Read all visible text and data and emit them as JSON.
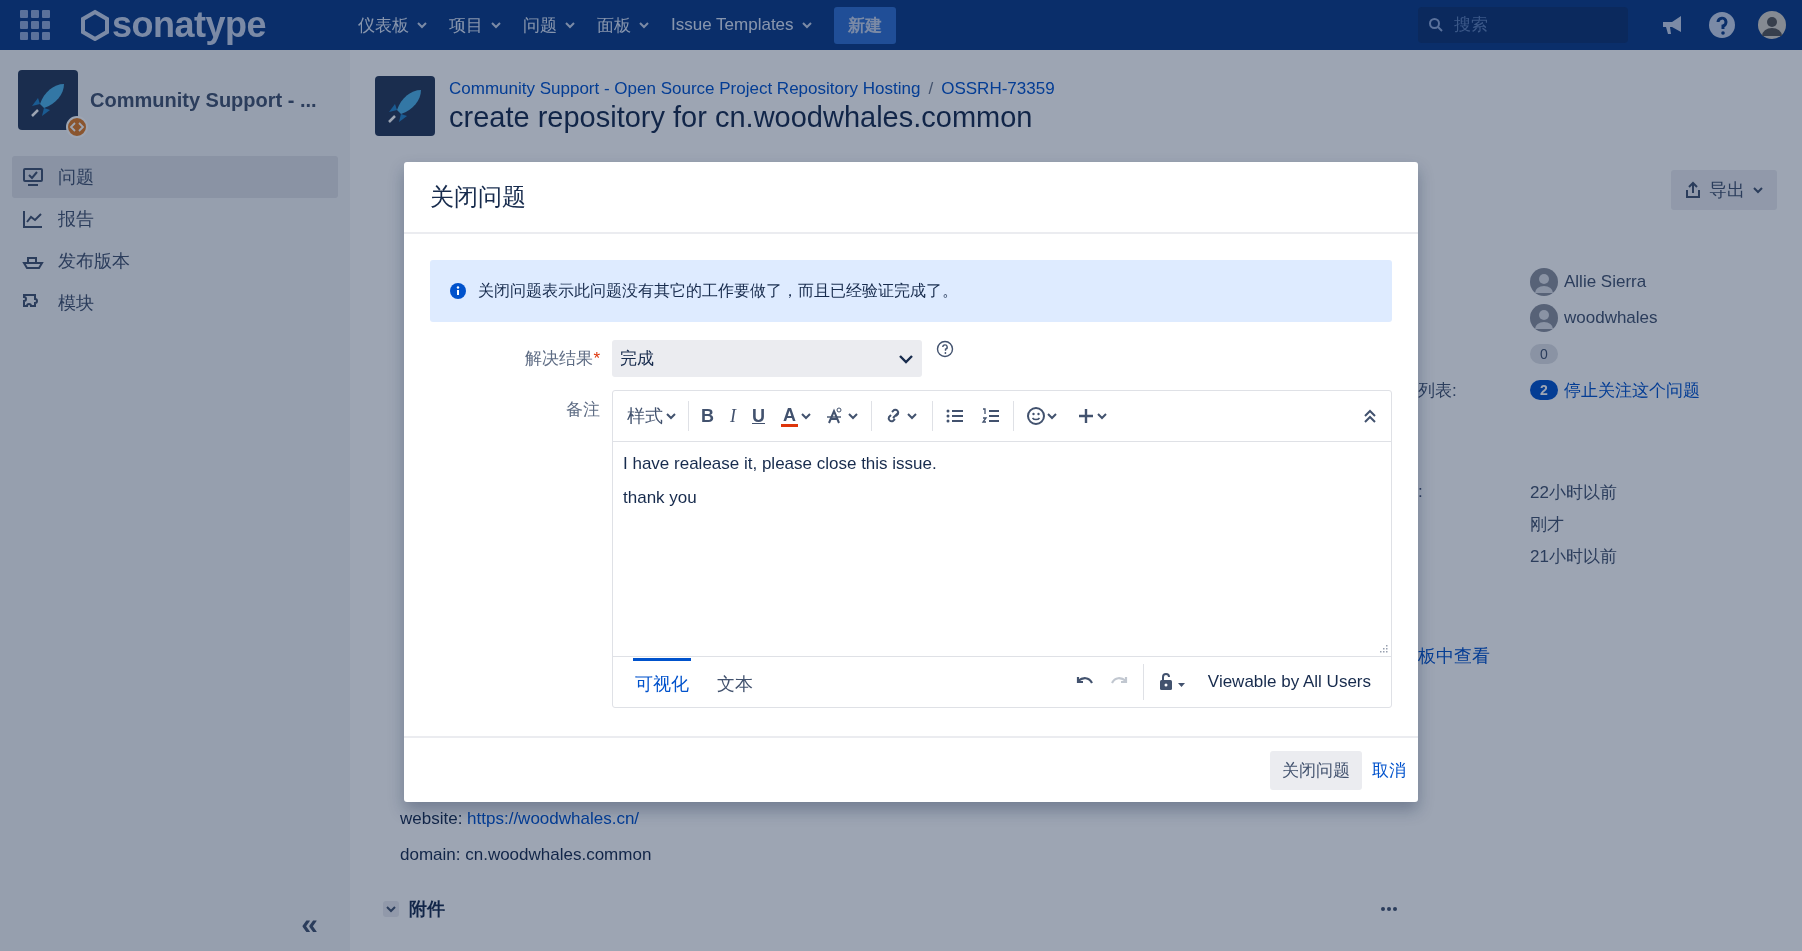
{
  "topbar": {
    "logo": "sonatype",
    "menus": [
      {
        "label": "仪表板"
      },
      {
        "label": "项目"
      },
      {
        "label": "问题"
      },
      {
        "label": "面板"
      },
      {
        "label": "Issue Templates"
      }
    ],
    "create": "新建",
    "search": {
      "placeholder": "搜索"
    }
  },
  "sidebar": {
    "project": "Community Support - ...",
    "items": [
      {
        "label": "问题",
        "kind": "issues",
        "selected": true
      },
      {
        "label": "报告",
        "kind": "reports",
        "selected": false
      },
      {
        "label": "发布版本",
        "kind": "releases",
        "selected": false
      },
      {
        "label": "模块",
        "kind": "components",
        "selected": false
      }
    ],
    "collapse": "«"
  },
  "issue": {
    "breadcrumb_separator": "/",
    "breadcrumbs": [
      "Community Support - Open Source Project Repository Hosting",
      "OSSRH-73359"
    ],
    "title": "create repository for cn.woodwhales.common",
    "export": "导出",
    "details": [
      {
        "label": "website: ",
        "link": "https://woodwhales.cn/"
      },
      {
        "label": "domain: cn.woodwhales.common"
      }
    ],
    "attachments": "附件",
    "people": [
      {
        "kind": "user",
        "value": "Allie Sierra"
      },
      {
        "kind": "user",
        "value": "woodwhales"
      },
      {
        "kind": "count",
        "value": "0"
      },
      {
        "kind": "watch",
        "label": "列表:",
        "count": "2",
        "value": "停止关注这个问题"
      }
    ],
    "dates": [
      {
        "label": ":",
        "value": "22小时以前"
      },
      {
        "value": "刚才"
      },
      {
        "value": "21小时以前"
      }
    ],
    "board_link": "板中查看"
  },
  "dialog": {
    "title": "关闭问题",
    "info": "关闭问题表示此问题没有其它的工作要做了，而且已经验证完成了。",
    "resolution": {
      "label": "解决结果",
      "required_mark": "*",
      "value": "完成"
    },
    "comment": {
      "label": "备注",
      "style_menu": "样式",
      "marks": [
        "B",
        "I",
        "U"
      ],
      "color_mark": "A",
      "lines": [
        "I have realease it, please close this issue.",
        "thank you"
      ],
      "tabs": [
        {
          "label": "可视化",
          "selected": true
        },
        {
          "label": "文本",
          "selected": false
        }
      ],
      "redo_disabled": true,
      "visibility": "Viewable by All Users"
    },
    "buttons": {
      "submit": "关闭问题",
      "cancel": "取消"
    }
  }
}
